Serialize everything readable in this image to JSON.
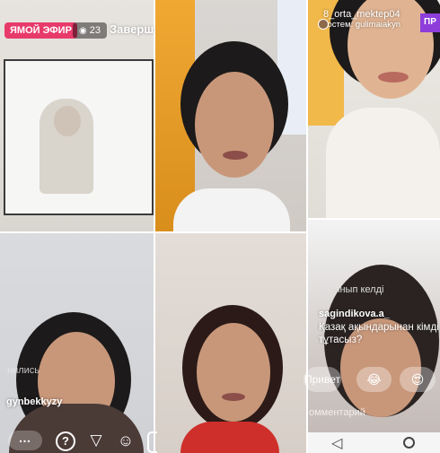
{
  "live_tile": {
    "badge_live": "ЯМОЙ ЭФИР",
    "viewer_icon": "eye-icon",
    "viewer_count": "23",
    "end_label": "Заверш"
  },
  "host_tile": {
    "username": "8_orta_mektep04",
    "guest_label": "Гостем: gulimaiakyn",
    "follow_badge": "ПР"
  },
  "comments": {
    "faded_text": "тұтынып келді",
    "username": "sagindikova.a_",
    "text": "Қазақ ақындарынан кімді тұтасыз?"
  },
  "reaction_chips": [
    {
      "label": "Привет"
    },
    {
      "label": "😂"
    },
    {
      "label": "😍"
    }
  ],
  "comment_input": {
    "placeholder": "омментарий"
  },
  "guest_tile": {
    "joined_text": "нились",
    "username": "gynbekkyzy"
  },
  "bottom_bar": {
    "more": "…",
    "question": "?",
    "send": "▽",
    "effects": "☺"
  },
  "nav_bar": {
    "back": "◁",
    "home": "○"
  },
  "colors": {
    "live_badge": "#e73a6b",
    "follow_badge": "#8e3ddb"
  }
}
